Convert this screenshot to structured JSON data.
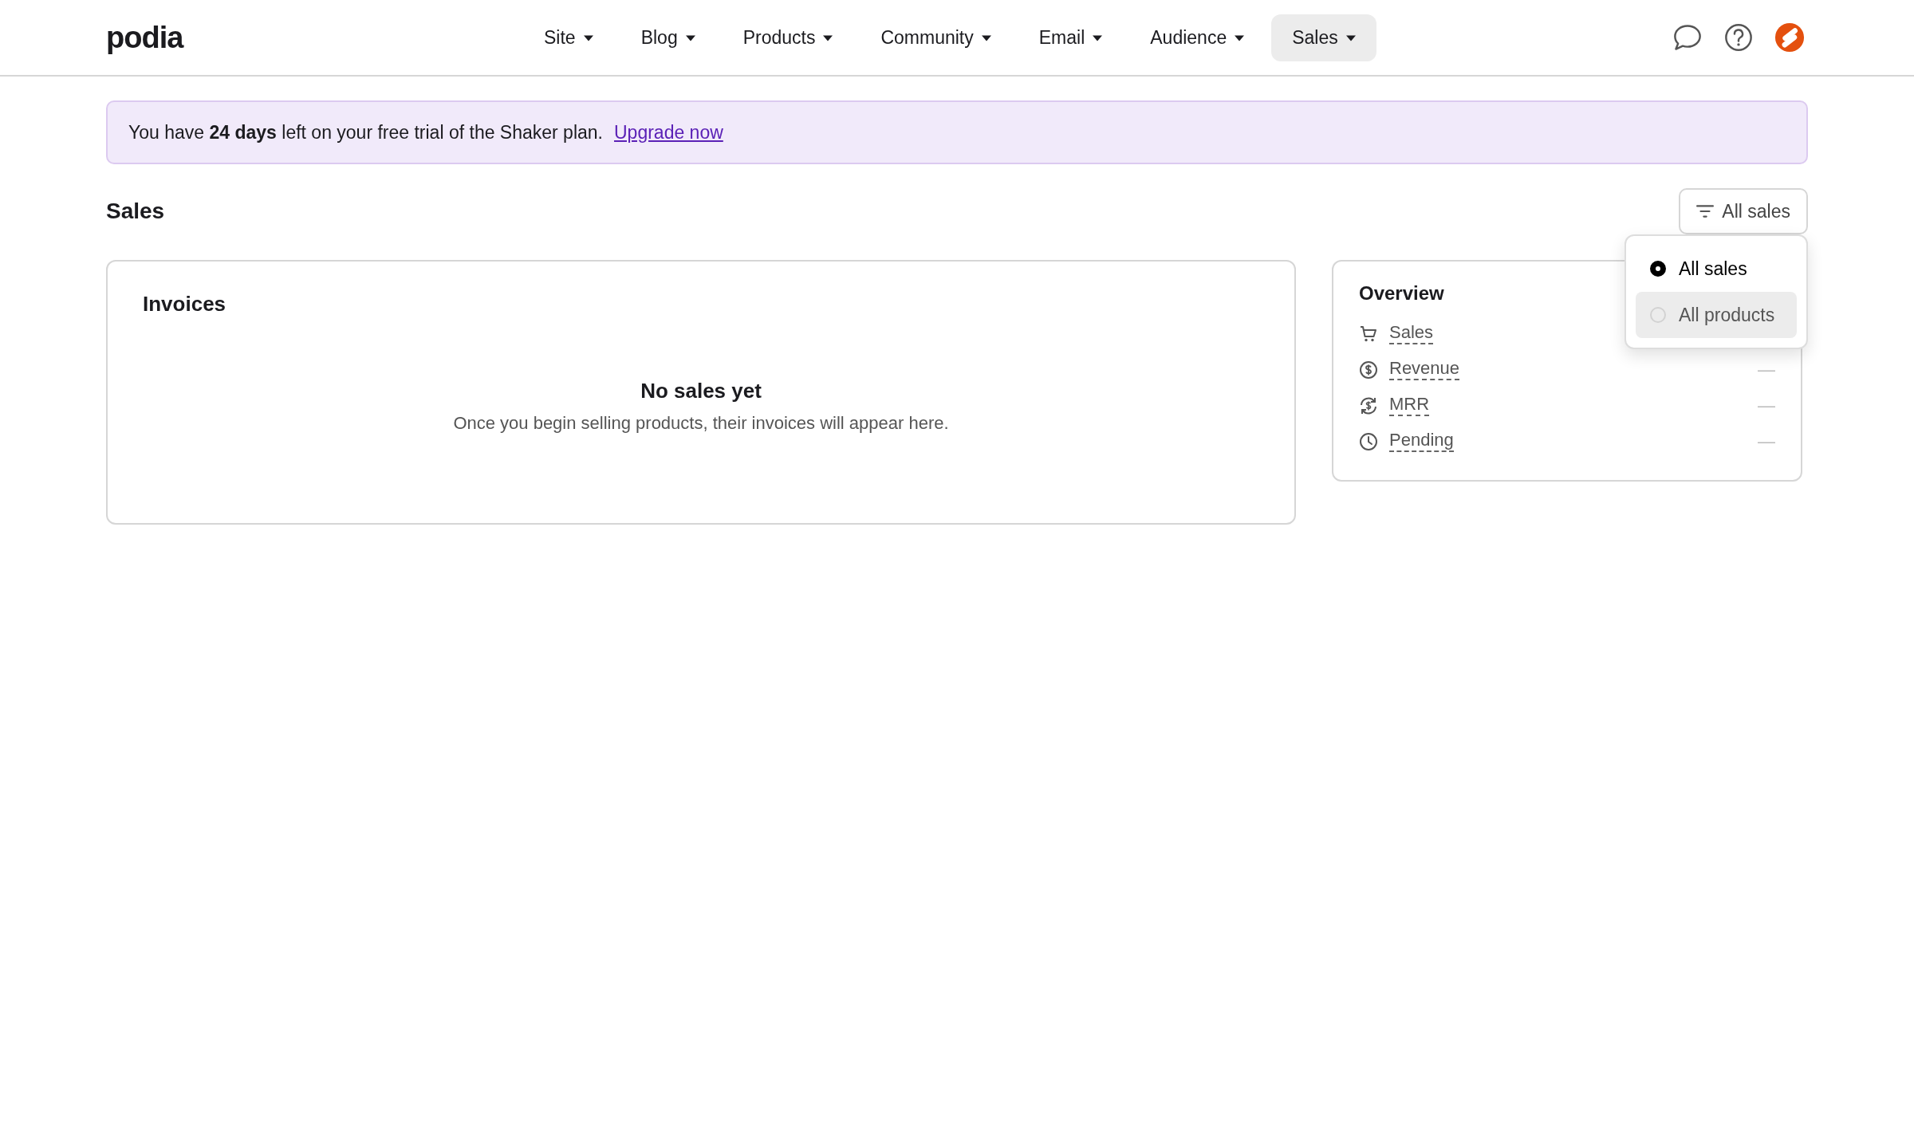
{
  "brand": "podia",
  "nav": [
    {
      "label": "Site",
      "selected": false
    },
    {
      "label": "Blog",
      "selected": false
    },
    {
      "label": "Products",
      "selected": false
    },
    {
      "label": "Community",
      "selected": false
    },
    {
      "label": "Email",
      "selected": false
    },
    {
      "label": "Audience",
      "selected": false
    },
    {
      "label": "Sales",
      "selected": true
    }
  ],
  "banner": {
    "text": "You have **24 days** left on your free trial of the Shaker plan.",
    "link": "Upgrade now"
  },
  "page_title": "Sales",
  "filter": {
    "label": "All sales",
    "options": [
      {
        "label": "All sales",
        "selected": true
      },
      {
        "label": "All products",
        "selected": false
      }
    ]
  },
  "invoices": {
    "title": "Invoices",
    "empty_title": "No sales yet",
    "empty_text": "Once you begin selling products, their invoices will appear here."
  },
  "overview": {
    "title": "Overview",
    "rows": [
      {
        "kind": "cart",
        "label": "Sales"
      },
      {
        "kind": "dollar",
        "label": "Revenue",
        "value": "—"
      },
      {
        "kind": "recurring",
        "label": "MRR",
        "value": "—"
      },
      {
        "kind": "clock",
        "label": "Pending",
        "value": "—"
      }
    ]
  }
}
